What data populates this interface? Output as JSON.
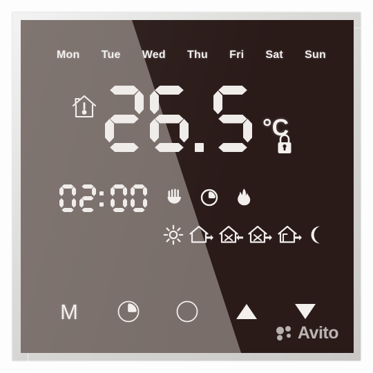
{
  "device": {
    "type": "touchscreen-thermostat",
    "panel_color": "#2a1b19",
    "reflection_color": "#7c726c",
    "display_text_color": "#f2efed",
    "bezel_color": "#d8d8d6"
  },
  "weekdays": [
    {
      "label": "Mon",
      "active": true
    },
    {
      "label": "Tue",
      "active": true
    },
    {
      "label": "Wed",
      "active": true
    },
    {
      "label": "Thu",
      "active": true
    },
    {
      "label": "Fri",
      "active": true
    },
    {
      "label": "Sat",
      "active": true
    },
    {
      "label": "Sun",
      "active": true
    }
  ],
  "temperature": {
    "value": "26.5",
    "digits": [
      "2",
      "6",
      ".",
      "5"
    ],
    "unit": "°C",
    "indoor_icon": "house-thermometer-icon"
  },
  "lock": {
    "icon": "padlock-icon",
    "state": "locked"
  },
  "clock": {
    "value": "02:00",
    "digits": [
      "0",
      "2",
      ":",
      "0",
      "0"
    ],
    "hours": "02",
    "minutes": "00"
  },
  "modes": [
    {
      "name": "manual-hand-icon",
      "label": "Manual"
    },
    {
      "name": "timer-clock-icon",
      "label": "Program"
    },
    {
      "name": "flame-heating-icon",
      "label": "Heating"
    }
  ],
  "periods": [
    {
      "name": "sun-icon",
      "label": "Wake"
    },
    {
      "name": "house-leave-icon",
      "label": "Leave"
    },
    {
      "name": "house-meal-return-icon",
      "label": "Return"
    },
    {
      "name": "house-meal-leave-icon",
      "label": "Out"
    },
    {
      "name": "house-return-icon",
      "label": "Home"
    },
    {
      "name": "moon-icon",
      "label": "Sleep"
    }
  ],
  "buttons": [
    {
      "name": "mode-button",
      "label": "M",
      "icon": "letter-m"
    },
    {
      "name": "clock-button",
      "label": "",
      "icon": "clock-pie-icon"
    },
    {
      "name": "power-button",
      "label": "",
      "icon": "power-circle-icon"
    },
    {
      "name": "increase-button",
      "label": "",
      "icon": "triangle-up-icon"
    },
    {
      "name": "decrease-button",
      "label": "",
      "icon": "triangle-down-icon"
    }
  ],
  "watermark": {
    "text": "Avito"
  }
}
